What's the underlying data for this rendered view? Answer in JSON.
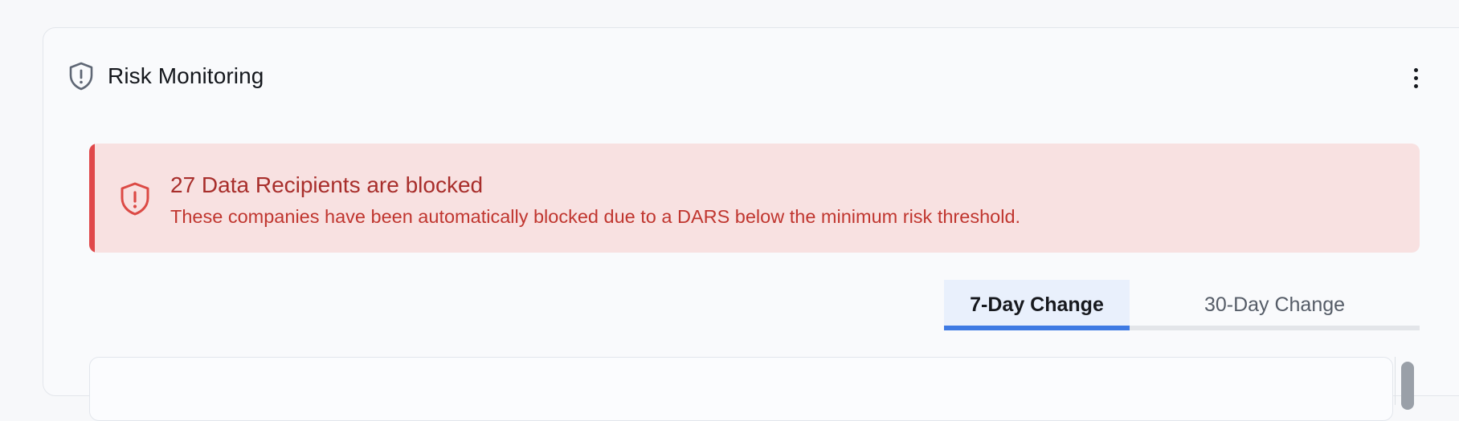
{
  "header": {
    "title": "Risk Monitoring",
    "icon": "shield-alert-icon",
    "menu_icon": "kebab-menu-icon"
  },
  "alert": {
    "title": "27 Data Recipients are blocked",
    "body": "These companies have been automatically blocked due to a DARS below the minimum risk threshold.",
    "icon": "shield-alert-icon",
    "colors": {
      "background": "#f8e1e1",
      "accent": "#e0484a",
      "title": "#a82e2b",
      "body": "#c0362f"
    }
  },
  "tabs": [
    {
      "label": "7-Day Change",
      "active": true
    },
    {
      "label": "30-Day Change",
      "active": false
    }
  ],
  "colors": {
    "tab_active_accent": "#3e7ae3",
    "tab_active_background": "#e9f0fc"
  }
}
